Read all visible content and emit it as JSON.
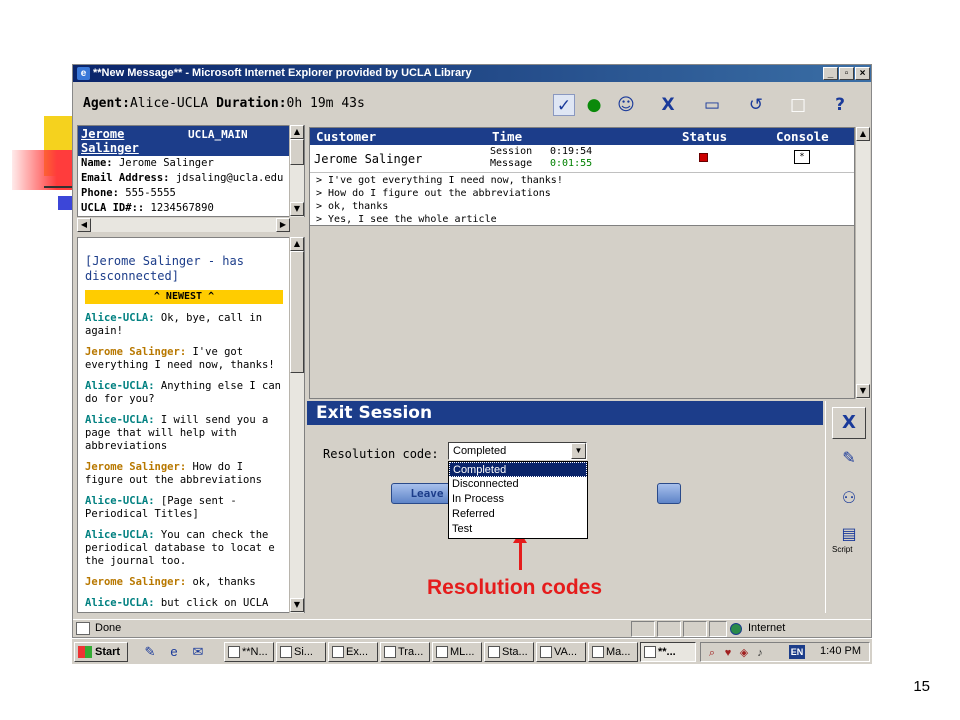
{
  "window": {
    "title": "**New Message** - Microsoft Internet Explorer provided by UCLA Library"
  },
  "agent_bar": {
    "agent_label": "Agent:",
    "agent_name": "Alice-UCLA",
    "duration_label": "Duration:",
    "duration_value": "0h 19m 43s"
  },
  "user_info": {
    "name_link": "Jerome Salinger",
    "branch": "UCLA_MAIN",
    "rows": [
      {
        "label": "Name:",
        "value": "Jerome Salinger"
      },
      {
        "label": "Email Address:",
        "value": "jdsaling@ucla.edu"
      },
      {
        "label": "Phone:",
        "value": "555-5555"
      },
      {
        "label": "UCLA ID#::",
        "value": "1234567890"
      }
    ]
  },
  "chat": {
    "disconnect_notice": "[Jerome Salinger - has disconnected]",
    "newest_label": "^ NEWEST ^",
    "messages": [
      {
        "speaker": "Alice-UCLA:",
        "text": "Ok, bye, call in again!"
      },
      {
        "speaker": "Jerome Salinger:",
        "text": "I've got everything I need now, thanks!"
      },
      {
        "speaker": "Alice-UCLA:",
        "text": "Anything else I can do for you?"
      },
      {
        "speaker": "Alice-UCLA:",
        "text": "I will send you a page that will help with abbreviations"
      },
      {
        "speaker": "Jerome Salinger:",
        "text": "How do I figure out the abbreviations"
      },
      {
        "speaker": "Alice-UCLA:",
        "text": "[Page sent - Periodical Titles]"
      },
      {
        "speaker": "Alice-UCLA:",
        "text": "You can check the periodical database to locat e the journal too."
      },
      {
        "speaker": "Jerome Salinger:",
        "text": "ok, thanks"
      },
      {
        "speaker": "Alice-UCLA:",
        "text": "but click on UCLA"
      }
    ]
  },
  "customer_table": {
    "headers": [
      "Customer",
      "Time",
      "Status",
      "Console"
    ],
    "row": {
      "customer": "Jerome Salinger",
      "session_label": "Session",
      "session_value": "0:19:54",
      "message_label": "Message",
      "message_value": "0:01:55"
    },
    "lines": [
      "> I've got everything I need now, thanks!",
      "> How do I figure out the abbreviations",
      "> ok, thanks",
      "> Yes, I see the whole article"
    ]
  },
  "exit_session": {
    "title": "Exit Session",
    "resolution_label": "Resolution code:",
    "selected": "Completed",
    "options": [
      "Completed",
      "Disconnected",
      "In Process",
      "Referred",
      "Test"
    ],
    "leave_label": "Leave"
  },
  "tool_column": {
    "script_label": "Script"
  },
  "status_bar": {
    "done": "Done",
    "zone": "Internet"
  },
  "taskbar": {
    "start": "Start",
    "tasks": [
      "**N...",
      "Si...",
      "Ex...",
      "Tra...",
      "ML...",
      "Sta...",
      "VA...",
      "Ma...",
      "**..."
    ],
    "lang": "EN",
    "clock": "1:40 PM"
  },
  "annotation": {
    "text": "Resolution codes"
  },
  "slide_number": "15"
}
